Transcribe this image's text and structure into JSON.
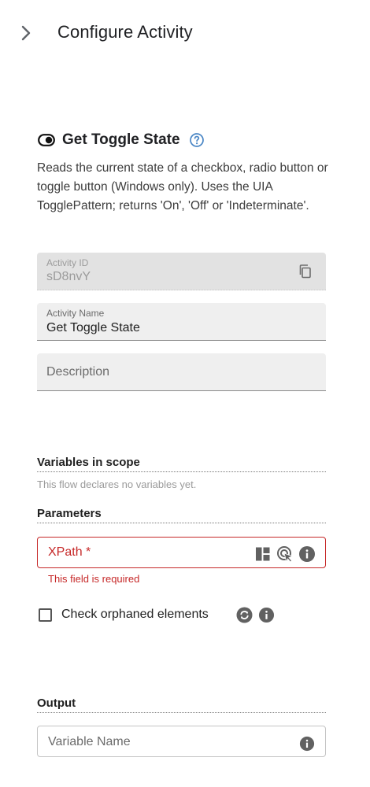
{
  "header": {
    "title": "Configure Activity",
    "back_icon": "chevron-right-icon"
  },
  "activity": {
    "title": "Get Toggle State",
    "icon": "toggle-icon",
    "help_icon": "help-circle-icon",
    "description": "Reads the current state of a checkbox, radio button or toggle button (Windows only). Uses the UIA TogglePattern; returns 'On', 'Off' or 'Indeterminate'."
  },
  "fields": {
    "activity_id": {
      "label": "Activity ID",
      "value": "sD8nvY",
      "icon": "copy-icon"
    },
    "activity_name": {
      "label": "Activity Name",
      "value": "Get Toggle State"
    },
    "description": {
      "placeholder": "Description"
    }
  },
  "variables": {
    "title": "Variables in scope",
    "note": "This flow declares no variables yet."
  },
  "parameters": {
    "title": "Parameters",
    "xpath": {
      "label": "XPath *",
      "error": "This field is required",
      "icons": [
        "layout-icon",
        "target-pointer-icon",
        "info-icon"
      ],
      "error_color": "#c62828"
    },
    "check_orphaned": {
      "label": "Check orphaned elements",
      "checked": false,
      "icons": [
        "refresh-icon",
        "info-icon"
      ]
    }
  },
  "output": {
    "title": "Output",
    "variable_name": {
      "placeholder": "Variable Name",
      "icon": "info-icon"
    }
  },
  "colors": {
    "accent_help": "#4a86c5",
    "icon_gray": "#616161"
  }
}
